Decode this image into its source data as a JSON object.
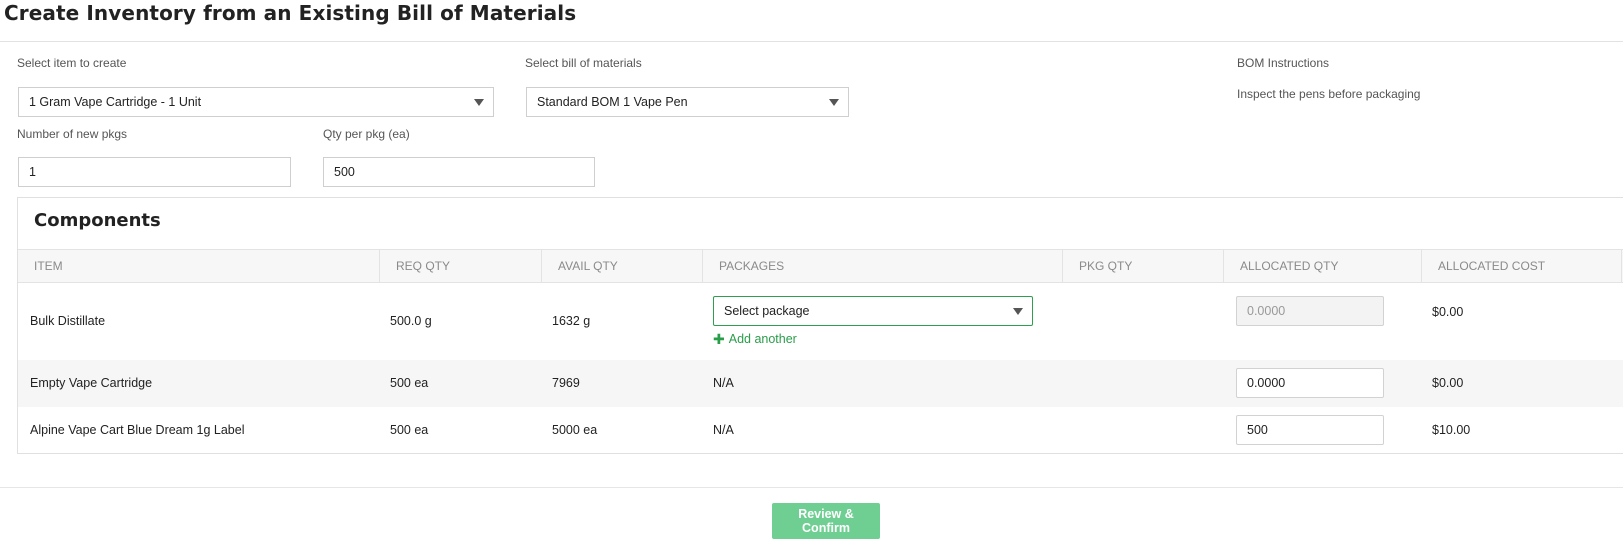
{
  "header": {
    "title": "Create Inventory from an Existing Bill of Materials"
  },
  "form": {
    "item_label": "Select item to create",
    "item_value": "1 Gram Vape Cartridge - 1 Unit",
    "bom_label": "Select bill of materials",
    "bom_value": "Standard BOM 1 Vape Pen",
    "bom_instructions_label": "BOM Instructions",
    "bom_instructions_text": "Inspect the pens before packaging",
    "num_pkgs_label": "Number of new pkgs",
    "num_pkgs_value": "1",
    "qty_per_pkg_label": "Qty per pkg (ea)",
    "qty_per_pkg_value": "500"
  },
  "components": {
    "title": "Components",
    "columns": [
      "ITEM",
      "REQ QTY",
      "AVAIL QTY",
      "PACKAGES",
      "PKG QTY",
      "ALLOCATED QTY",
      "ALLOCATED COST"
    ],
    "rows": [
      {
        "item": "Bulk Distillate",
        "req_qty": "500.0 g",
        "avail_qty": "1632 g",
        "package_select": "Select package",
        "add_another": "Add another",
        "allocated_qty": "0.0000",
        "allocated_cost": "$0.00"
      },
      {
        "item": "Empty Vape Cartridge",
        "req_qty": "500 ea",
        "avail_qty": "7969",
        "packages": "N/A",
        "allocated_qty": "0.0000",
        "allocated_cost": "$0.00"
      },
      {
        "item": "Alpine Vape Cart Blue Dream 1g Label",
        "req_qty": "500 ea",
        "avail_qty": "5000 ea",
        "packages": "N/A",
        "allocated_qty": "500",
        "allocated_cost": "$10.00"
      }
    ]
  },
  "footer": {
    "review_button": "Review & Confirm"
  },
  "colors": {
    "accent_green": "#2e9e4f",
    "button_green": "#6fcf93"
  },
  "icons": {
    "select_caret": "caret-down-icon",
    "add": "plus-icon"
  }
}
